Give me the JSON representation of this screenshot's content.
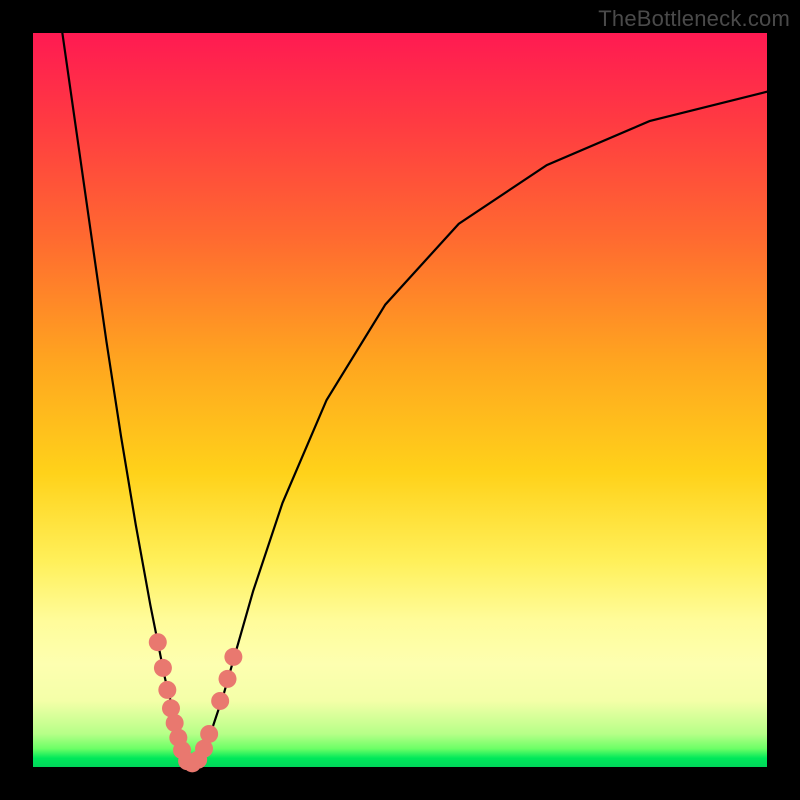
{
  "watermark": "TheBottleneck.com",
  "chart_data": {
    "type": "line",
    "title": "",
    "xlabel": "",
    "ylabel": "",
    "xlim": [
      0,
      100
    ],
    "ylim": [
      0,
      100
    ],
    "series": [
      {
        "name": "bottleneck-curve",
        "x": [
          4,
          6,
          8,
          10,
          12,
          14,
          16,
          18,
          19,
          20,
          21,
          22,
          23,
          24,
          26,
          28,
          30,
          34,
          40,
          48,
          58,
          70,
          84,
          100
        ],
        "values": [
          100,
          86,
          72,
          58,
          45,
          33,
          22,
          12,
          8,
          4,
          1,
          0,
          1,
          4,
          10,
          17,
          24,
          36,
          50,
          63,
          74,
          82,
          88,
          92
        ]
      }
    ],
    "markers": {
      "name": "data-points",
      "x": [
        17.0,
        17.7,
        18.3,
        18.8,
        19.3,
        19.8,
        20.3,
        21.0,
        21.7,
        22.5,
        23.3,
        24.0,
        25.5,
        26.5,
        27.3
      ],
      "values": [
        17.0,
        13.5,
        10.5,
        8.0,
        6.0,
        4.0,
        2.3,
        0.8,
        0.5,
        1.0,
        2.5,
        4.5,
        9.0,
        12.0,
        15.0
      ],
      "color": "#e9786f",
      "radius_px": 9
    },
    "colors": {
      "curve": "#000000",
      "gradient_top": "#ff1a52",
      "gradient_bottom": "#00d65a"
    }
  }
}
